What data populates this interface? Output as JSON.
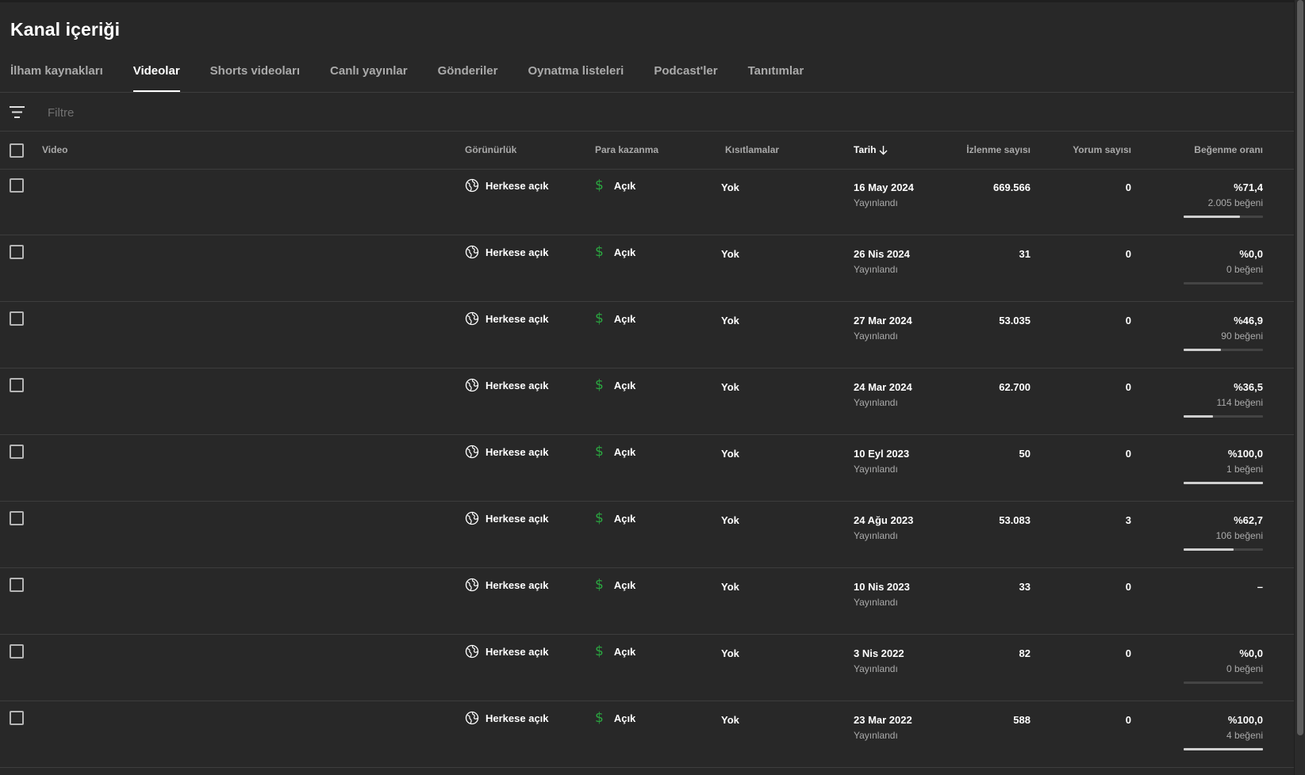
{
  "page": {
    "title": "Kanal içeriği"
  },
  "tabs": [
    {
      "label": "İlham kaynakları",
      "active": false
    },
    {
      "label": "Videolar",
      "active": true
    },
    {
      "label": "Shorts videoları",
      "active": false
    },
    {
      "label": "Canlı yayınlar",
      "active": false
    },
    {
      "label": "Gönderiler",
      "active": false
    },
    {
      "label": "Oynatma listeleri",
      "active": false
    },
    {
      "label": "Podcast'ler",
      "active": false
    },
    {
      "label": "Tanıtımlar",
      "active": false
    }
  ],
  "filter": {
    "placeholder": "Filtre",
    "icon": "filter-icon"
  },
  "table": {
    "headers": {
      "video": "Video",
      "visibility": "Görünürlük",
      "monetization": "Para kazanma",
      "restrictions": "Kısıtlamalar",
      "date": "Tarih",
      "views": "İzlenme sayısı",
      "comments": "Yorum sayısı",
      "like_ratio": "Beğenme oranı"
    },
    "sort": {
      "column": "date",
      "direction": "descending",
      "icon": "arrow-down-icon"
    },
    "rows": [
      {
        "visibility": "Herkese açık",
        "monetization": "Açık",
        "restrictions": "Yok",
        "date": "16 May 2024",
        "status": "Yayınlandı",
        "views": "669.566",
        "comments": "0",
        "like_pct": "%71,4",
        "likes": "2.005 beğeni",
        "like_ratio": 0.714
      },
      {
        "visibility": "Herkese açık",
        "monetization": "Açık",
        "restrictions": "Yok",
        "date": "26 Nis 2024",
        "status": "Yayınlandı",
        "views": "31",
        "comments": "0",
        "like_pct": "%0,0",
        "likes": "0 beğeni",
        "like_ratio": 0.0
      },
      {
        "visibility": "Herkese açık",
        "monetization": "Açık",
        "restrictions": "Yok",
        "date": "27 Mar 2024",
        "status": "Yayınlandı",
        "views": "53.035",
        "comments": "0",
        "like_pct": "%46,9",
        "likes": "90 beğeni",
        "like_ratio": 0.469
      },
      {
        "visibility": "Herkese açık",
        "monetization": "Açık",
        "restrictions": "Yok",
        "date": "24 Mar 2024",
        "status": "Yayınlandı",
        "views": "62.700",
        "comments": "0",
        "like_pct": "%36,5",
        "likes": "114 beğeni",
        "like_ratio": 0.365
      },
      {
        "visibility": "Herkese açık",
        "monetization": "Açık",
        "restrictions": "Yok",
        "date": "10 Eyl 2023",
        "status": "Yayınlandı",
        "views": "50",
        "comments": "0",
        "like_pct": "%100,0",
        "likes": "1 beğeni",
        "like_ratio": 1.0
      },
      {
        "visibility": "Herkese açık",
        "monetization": "Açık",
        "restrictions": "Yok",
        "date": "24 Ağu 2023",
        "status": "Yayınlandı",
        "views": "53.083",
        "comments": "3",
        "like_pct": "%62,7",
        "likes": "106 beğeni",
        "like_ratio": 0.627
      },
      {
        "visibility": "Herkese açık",
        "monetization": "Açık",
        "restrictions": "Yok",
        "date": "10 Nis 2023",
        "status": "Yayınlandı",
        "views": "33",
        "comments": "0",
        "like_pct": "–",
        "likes": "",
        "like_ratio": null
      },
      {
        "visibility": "Herkese açık",
        "monetization": "Açık",
        "restrictions": "Yok",
        "date": "3 Nis 2022",
        "status": "Yayınlandı",
        "views": "82",
        "comments": "0",
        "like_pct": "%0,0",
        "likes": "0 beğeni",
        "like_ratio": 0.0
      },
      {
        "visibility": "Herkese açık",
        "monetization": "Açık",
        "restrictions": "Yok",
        "date": "23 Mar 2022",
        "status": "Yayınlandı",
        "views": "588",
        "comments": "0",
        "like_pct": "%100,0",
        "likes": "4 beğeni",
        "like_ratio": 1.0
      }
    ]
  },
  "colors": {
    "background": "#282828",
    "monetization_green": "#2ba640",
    "text_primary": "#ffffff",
    "text_secondary": "#aaaaaa"
  }
}
